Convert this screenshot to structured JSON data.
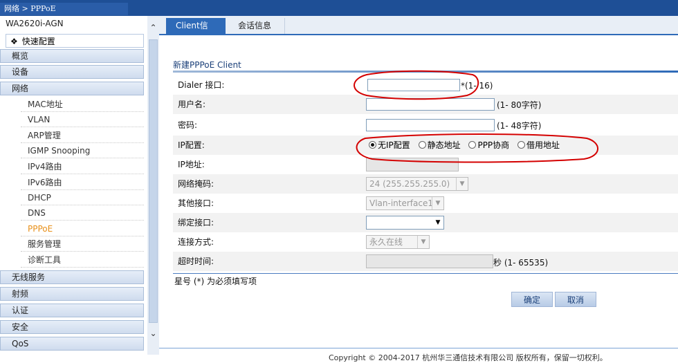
{
  "breadcrumb": "网络 > PPPoE",
  "sidebar": {
    "device": "WA2620i-AGN",
    "quick_config": "快速配置",
    "categories": {
      "overview": "概览",
      "device": "设备",
      "network": "网络",
      "wireless": "无线服务",
      "radio": "射频",
      "auth": "认证",
      "security": "安全",
      "qos": "QoS"
    },
    "network_items": [
      "MAC地址",
      "VLAN",
      "ARP管理",
      "IGMP Snooping",
      "IPv4路由",
      "IPv6路由",
      "DHCP",
      "DNS",
      "PPPoE",
      "服务管理",
      "诊断工具"
    ],
    "active_item": "PPPoE"
  },
  "tabs": [
    "Client信息",
    "会话信息"
  ],
  "form": {
    "section_title": "新建PPPoE Client",
    "dialer_label": "Dialer 接口:",
    "dialer_hint": "*(1- 16)",
    "username_label": "用户名:",
    "username_hint": "(1- 80字符)",
    "password_label": "密码:",
    "password_hint": "(1- 48字符)",
    "ip_config_label": "IP配置:",
    "ip_options": [
      "无IP配置",
      "静态地址",
      "PPP协商",
      "借用地址"
    ],
    "ip_selected": "无IP配置",
    "ip_address_label": "IP地址:",
    "mask_label": "网络掩码:",
    "mask_value": "24 (255.255.255.0)",
    "other_if_label": "其他接口:",
    "other_if_value": "Vlan-interface1",
    "bind_if_label": "绑定接口:",
    "bind_if_value": "",
    "conn_mode_label": "连接方式:",
    "conn_mode_value": "永久在线",
    "timeout_label": "超时时间:",
    "timeout_hint": "秒 (1- 65535)",
    "required_note": "星号 (*) 为必须填写项",
    "ok_button": "确定",
    "cancel_button": "取消"
  },
  "footer": "Copyright © 2004-2017 杭州华三通信技术有限公司 版权所有，保留一切权利。",
  "colors": {
    "header": "#1e4f96",
    "accent": "#2e6ab8",
    "active_item": "#e8901a",
    "annotation": "#d40000"
  }
}
